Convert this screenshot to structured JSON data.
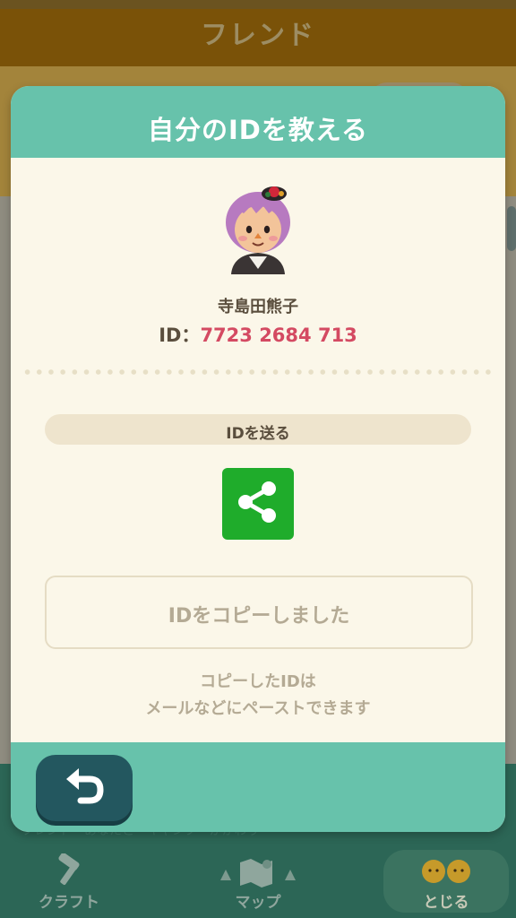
{
  "background": {
    "header_title": "フレンド",
    "ghost_text": "フレンド・あなたと・キャンプ・かかわり",
    "tabs": [
      {
        "label": "クラフト",
        "icon": "hammer-icon"
      },
      {
        "label": "マップ",
        "icon": "map-icon"
      },
      {
        "label": "とじる",
        "icon": "villagers-icon"
      }
    ]
  },
  "dialog": {
    "title": "自分のIDを教える",
    "user_name": "寺島田熊子",
    "id_label": "ID：",
    "id_value": "7723 2684 713",
    "send_section_label": "IDを送る",
    "share_icon": "share-icon",
    "copy_button_label": "IDをコピーしました",
    "copy_note_line1": "コピーしたIDは",
    "copy_note_line2": "メールなどにペーストできます"
  },
  "colors": {
    "accent": "#67c2ab",
    "id_value": "#d44a62",
    "share_green": "#1fac2b",
    "back_button": "#23575f"
  },
  "back_button_icon": "back-arrow-icon"
}
